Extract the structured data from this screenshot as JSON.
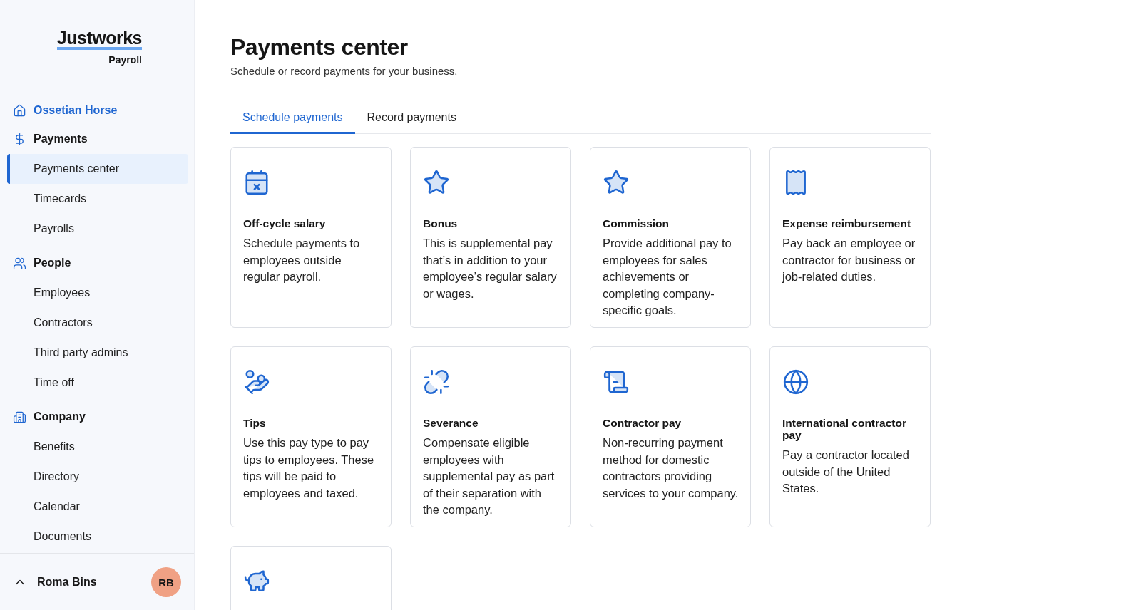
{
  "sidebar": {
    "logo": "Justworks",
    "product": "Payroll",
    "company": {
      "label": "Ossetian Horse",
      "kind": "home"
    },
    "sections": [
      {
        "label": "Payments",
        "kind": "dollar",
        "items": [
          {
            "label": "Payments center",
            "selected": true
          },
          {
            "label": "Timecards",
            "selected": false
          },
          {
            "label": "Payrolls",
            "selected": false
          }
        ]
      },
      {
        "label": "People",
        "kind": "people",
        "items": [
          {
            "label": "Employees",
            "selected": false
          },
          {
            "label": "Contractors",
            "selected": false
          },
          {
            "label": "Third party admins",
            "selected": false
          },
          {
            "label": "Time off",
            "selected": false
          }
        ]
      },
      {
        "label": "Company",
        "kind": "building",
        "items": [
          {
            "label": "Benefits",
            "selected": false
          },
          {
            "label": "Directory",
            "selected": false
          },
          {
            "label": "Calendar",
            "selected": false
          },
          {
            "label": "Documents",
            "selected": false
          }
        ]
      }
    ],
    "user": {
      "name": "Roma Bins",
      "initials": "RB"
    }
  },
  "page": {
    "title": "Payments center",
    "subtitle": "Schedule or record payments for your business."
  },
  "tabs": [
    {
      "label": "Schedule payments",
      "selected": true
    },
    {
      "label": "Record payments",
      "selected": false
    }
  ],
  "cards": [
    {
      "kind": "calendar",
      "title": "Off-cycle salary",
      "text": "Schedule payments to employees outside regular payroll."
    },
    {
      "kind": "star",
      "title": "Bonus",
      "text": "This is supplemental pay that’s in addition to your employee’s regular salary or wages."
    },
    {
      "kind": "star",
      "title": "Commission",
      "text": "Provide additional pay to employees for sales achievements or completing company-specific goals."
    },
    {
      "kind": "receipt",
      "title": "Expense reimbursement",
      "text": "Pay back an employee or contractor for business or job-related duties."
    },
    {
      "kind": "hand",
      "title": "Tips",
      "text": "Use this pay type to pay tips to employees. These tips will be paid to employees and taxed."
    },
    {
      "kind": "unlink",
      "title": "Severance",
      "text": "Compensate eligible employees with supplemental pay as part of their separation with the company."
    },
    {
      "kind": "scroll",
      "title": "Contractor pay",
      "text": "Non-recurring payment method for domestic contractors providing services to your company."
    },
    {
      "kind": "globe",
      "title": "International contractor pay",
      "text": "Pay a contractor located outside of the United States."
    },
    {
      "kind": "piggy"
    }
  ]
}
